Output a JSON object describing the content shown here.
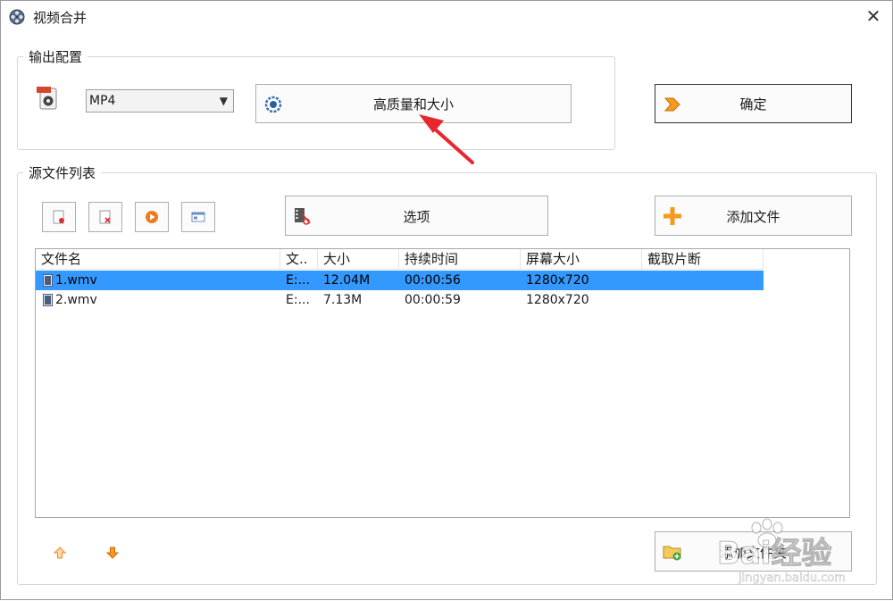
{
  "window": {
    "title": "视频合并",
    "close_glyph": "✕"
  },
  "output_group": {
    "legend": "输出配置",
    "format_select": {
      "value": "MP4"
    },
    "quality_button": {
      "label": "高质量和大小",
      "icon": "quality-gear-icon"
    },
    "ok_button": {
      "label": "确定",
      "icon": "arrow-right-icon"
    }
  },
  "source_group": {
    "legend": "源文件列表",
    "toolbar": [
      {
        "name": "clear-list",
        "icon": "clear-list-icon"
      },
      {
        "name": "remove-file",
        "icon": "remove-file-icon"
      },
      {
        "name": "play",
        "icon": "play-icon"
      },
      {
        "name": "properties",
        "icon": "properties-icon"
      }
    ],
    "options_button": {
      "label": "选项",
      "icon": "film-cut-icon"
    },
    "add_file_button": {
      "label": "添加文件",
      "icon": "plus-icon"
    },
    "add_folder_button": {
      "label": "添加文件夹",
      "icon": "add-folder-icon"
    },
    "columns": [
      "文件名",
      "文..",
      "大小",
      "持续时间",
      "屏幕大小",
      "截取片断"
    ],
    "files": [
      {
        "name": "1.wmv",
        "dir": "E:...",
        "size": "12.04M",
        "duration": "00:00:56",
        "resolution": "1280x720",
        "clip": "",
        "selected": true
      },
      {
        "name": "2.wmv",
        "dir": "E:...",
        "size": "7.13M",
        "duration": "00:00:59",
        "resolution": "1280x720",
        "clip": "",
        "selected": false
      }
    ]
  },
  "watermark": {
    "brand": "Bai经验",
    "url": "jingyan.baidu.com"
  },
  "colors": {
    "selection": "#3399ff",
    "annotation_arrow": "#e8262d",
    "accent_orange": "#f39a1f"
  }
}
